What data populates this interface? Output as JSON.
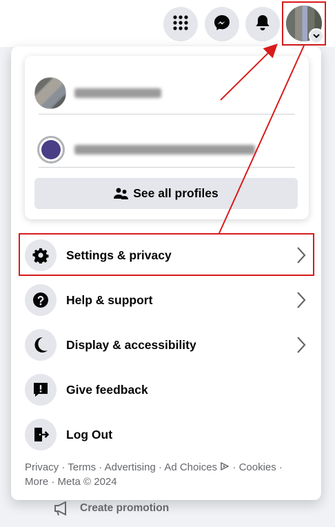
{
  "topbar": {
    "menu_icon": "grid-menu-icon",
    "messenger_icon": "messenger-icon",
    "notifications_icon": "bell-icon",
    "account_icon": "avatar"
  },
  "profiles": {
    "see_all_label": "See all profiles",
    "see_all_icon": "profiles-icon"
  },
  "menu": {
    "items": [
      {
        "label": "Settings & privacy",
        "icon": "gear-icon",
        "has_chevron": true
      },
      {
        "label": "Help & support",
        "icon": "question-icon",
        "has_chevron": true
      },
      {
        "label": "Display & accessibility",
        "icon": "moon-icon",
        "has_chevron": true
      },
      {
        "label": "Give feedback",
        "icon": "feedback-icon",
        "has_chevron": false
      },
      {
        "label": "Log Out",
        "icon": "logout-icon",
        "has_chevron": false
      }
    ]
  },
  "footer": {
    "privacy": "Privacy",
    "terms": "Terms",
    "advertising": "Advertising",
    "ad_choices": "Ad Choices",
    "cookies": "Cookies",
    "more": "More",
    "meta": "Meta © 2024",
    "sep": " · "
  },
  "below": {
    "create_promotion": "Create promotion"
  },
  "colors": {
    "highlight": "#d81b1b",
    "icon_bg": "#e4e6eb",
    "secondary_text": "#65676b"
  }
}
